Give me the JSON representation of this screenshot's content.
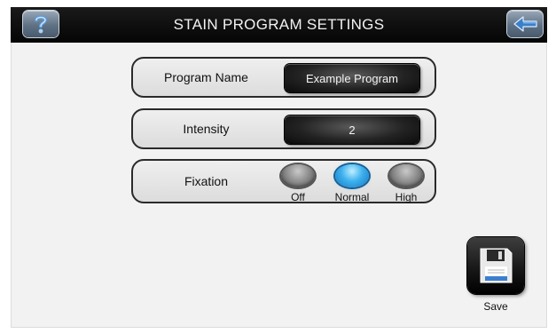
{
  "header": {
    "title": "STAIN PROGRAM SETTINGS",
    "help_icon": "help-icon",
    "back_icon": "back-arrow-icon"
  },
  "settings": {
    "program_name": {
      "label": "Program Name",
      "value": "Example Program"
    },
    "intensity": {
      "label": "Intensity",
      "value": "2"
    },
    "fixation": {
      "label": "Fixation",
      "options": [
        "Off",
        "Normal",
        "High"
      ],
      "selected": "Normal"
    }
  },
  "footer": {
    "save_label": "Save",
    "save_icon": "floppy-disk-icon"
  },
  "colors": {
    "header_bg": "#0a0a0a",
    "selected_radio": "#3cb0ee",
    "field_bg": "#1e1e1e"
  }
}
